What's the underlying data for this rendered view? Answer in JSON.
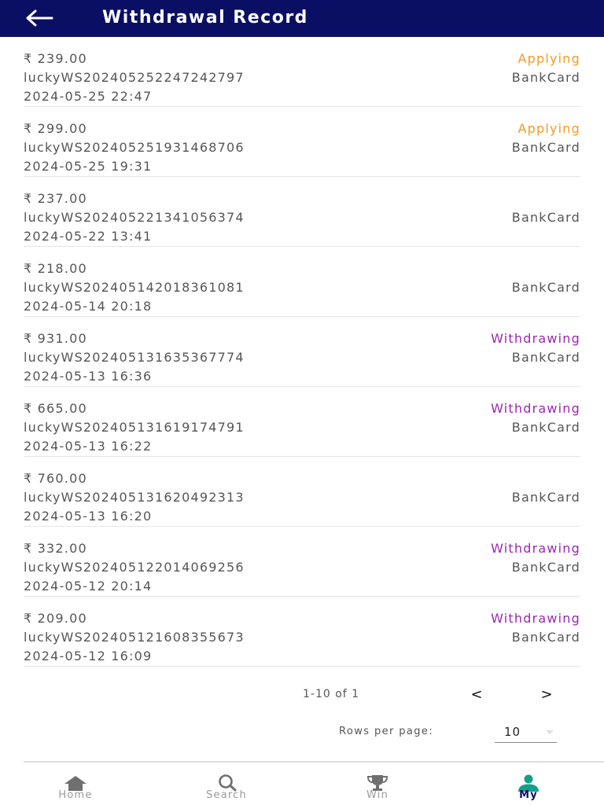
{
  "header": {
    "title": "Withdrawal Record"
  },
  "records": [
    {
      "amount": "₹ 239.00",
      "order_no": "luckyWS202405252247242797",
      "time": "2024-05-25 22:47",
      "status": "Applying",
      "method": "BankCard"
    },
    {
      "amount": "₹ 299.00",
      "order_no": "luckyWS202405251931468706",
      "time": "2024-05-25 19:31",
      "status": "Applying",
      "method": "BankCard"
    },
    {
      "amount": "₹ 237.00",
      "order_no": "luckyWS202405221341056374",
      "time": "2024-05-22 13:41",
      "status": "",
      "method": "BankCard"
    },
    {
      "amount": "₹ 218.00",
      "order_no": "luckyWS202405142018361081",
      "time": "2024-05-14 20:18",
      "status": "",
      "method": "BankCard"
    },
    {
      "amount": "₹ 931.00",
      "order_no": "luckyWS202405131635367774",
      "time": "2024-05-13 16:36",
      "status": "Withdrawing",
      "method": "BankCard"
    },
    {
      "amount": "₹ 665.00",
      "order_no": "luckyWS202405131619174791",
      "time": "2024-05-13 16:22",
      "status": "Withdrawing",
      "method": "BankCard"
    },
    {
      "amount": "₹ 760.00",
      "order_no": "luckyWS202405131620492313",
      "time": "2024-05-13 16:20",
      "status": "",
      "method": "BankCard"
    },
    {
      "amount": "₹ 332.00",
      "order_no": "luckyWS202405122014069256",
      "time": "2024-05-12 20:14",
      "status": "Withdrawing",
      "method": "BankCard"
    },
    {
      "amount": "₹ 209.00",
      "order_no": "luckyWS202405121608355673",
      "time": "2024-05-12 16:09",
      "status": "Withdrawing",
      "method": "BankCard"
    }
  ],
  "pagination": {
    "range": "1-10 of 1",
    "prev": "<",
    "next": ">",
    "rows_label": "Rows per page:",
    "rows_value": "10"
  },
  "nav": {
    "items": [
      {
        "label": "Home",
        "icon": "home-icon",
        "active": false
      },
      {
        "label": "Search",
        "icon": "search-icon",
        "active": false
      },
      {
        "label": "Win",
        "icon": "trophy-icon",
        "active": false
      },
      {
        "label": "My",
        "icon": "user-icon",
        "active": true
      }
    ]
  },
  "colors": {
    "header_bg": "#0b0f63",
    "applying": "#f39a26",
    "withdrawing": "#9b27af",
    "active_icon": "#12a08a",
    "inactive_icon": "#6f6f6f"
  }
}
